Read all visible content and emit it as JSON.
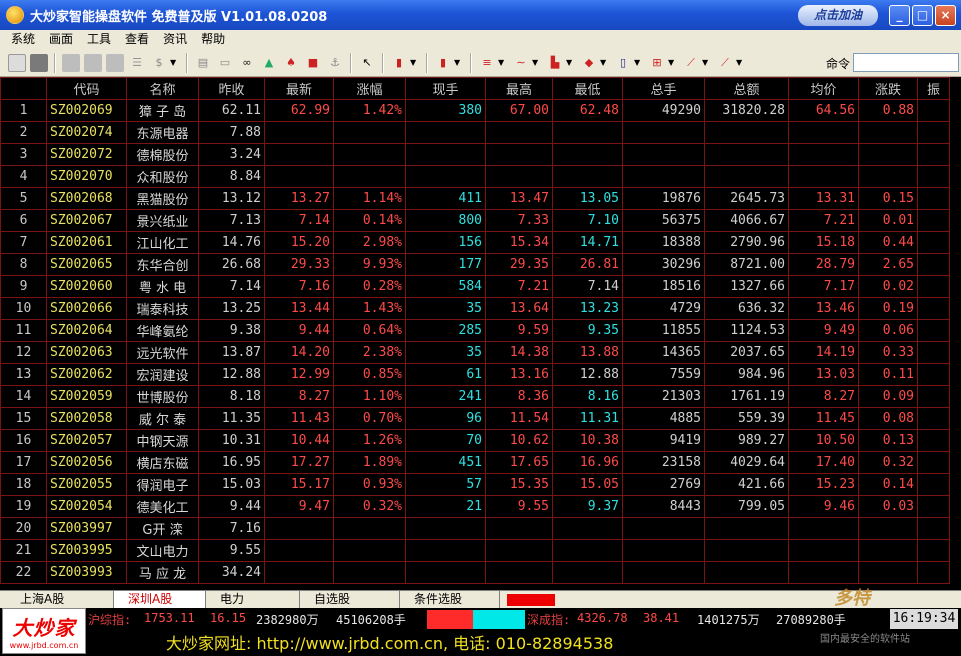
{
  "window": {
    "title": "大炒家智能操盘软件 免费普及版 V1.01.08.0208",
    "sponsor": "点击加油",
    "btn_min": "_",
    "btn_max": "□",
    "btn_close": "×"
  },
  "menu": [
    "系统",
    "画面",
    "工具",
    "查看",
    "资讯",
    "帮助"
  ],
  "toolbar": {
    "command_label": "命令",
    "command_value": ""
  },
  "columns": [
    "",
    "代码",
    "名称",
    "昨收",
    "最新",
    "涨幅",
    "现手",
    "最高",
    "最低",
    "总手",
    "总额",
    "均价",
    "涨跌",
    "振"
  ],
  "rows": [
    {
      "idx": "1",
      "code": "SZ002069",
      "name": "獐 子 岛",
      "prev": "62.11",
      "last": "62.99",
      "pct": "1.42%",
      "vol": "380",
      "high": "67.00",
      "low": "62.48",
      "total": "49290",
      "amount": "31820.28",
      "avg": "64.56",
      "chg": "0.88"
    },
    {
      "idx": "2",
      "code": "SZ002074",
      "name": "东源电器",
      "prev": "7.88",
      "last": "",
      "pct": "",
      "vol": "",
      "high": "",
      "low": "",
      "total": "",
      "amount": "",
      "avg": "",
      "chg": ""
    },
    {
      "idx": "3",
      "code": "SZ002072",
      "name": "德棉股份",
      "prev": "3.24",
      "last": "",
      "pct": "",
      "vol": "",
      "high": "",
      "low": "",
      "total": "",
      "amount": "",
      "avg": "",
      "chg": ""
    },
    {
      "idx": "4",
      "code": "SZ002070",
      "name": "众和股份",
      "prev": "8.84",
      "last": "",
      "pct": "",
      "vol": "",
      "high": "",
      "low": "",
      "total": "",
      "amount": "",
      "avg": "",
      "chg": ""
    },
    {
      "idx": "5",
      "code": "SZ002068",
      "name": "黑猫股份",
      "prev": "13.12",
      "last": "13.27",
      "pct": "1.14%",
      "vol": "411",
      "high": "13.47",
      "low": "13.05",
      "total": "19876",
      "amount": "2645.73",
      "avg": "13.31",
      "chg": "0.15"
    },
    {
      "idx": "6",
      "code": "SZ002067",
      "name": "景兴纸业",
      "prev": "7.13",
      "last": "7.14",
      "pct": "0.14%",
      "vol": "800",
      "high": "7.33",
      "low": "7.10",
      "total": "56375",
      "amount": "4066.67",
      "avg": "7.21",
      "chg": "0.01"
    },
    {
      "idx": "7",
      "code": "SZ002061",
      "name": "江山化工",
      "prev": "14.76",
      "last": "15.20",
      "pct": "2.98%",
      "vol": "156",
      "high": "15.34",
      "low": "14.71",
      "total": "18388",
      "amount": "2790.96",
      "avg": "15.18",
      "chg": "0.44"
    },
    {
      "idx": "8",
      "code": "SZ002065",
      "name": "东华合创",
      "prev": "26.68",
      "last": "29.33",
      "pct": "9.93%",
      "vol": "177",
      "high": "29.35",
      "low": "26.81",
      "total": "30296",
      "amount": "8721.00",
      "avg": "28.79",
      "chg": "2.65"
    },
    {
      "idx": "9",
      "code": "SZ002060",
      "name": "粤 水 电",
      "prev": "7.14",
      "last": "7.16",
      "pct": "0.28%",
      "vol": "584",
      "high": "7.21",
      "low": "7.14",
      "total": "18516",
      "amount": "1327.66",
      "avg": "7.17",
      "chg": "0.02"
    },
    {
      "idx": "10",
      "code": "SZ002066",
      "name": "瑞泰科技",
      "prev": "13.25",
      "last": "13.44",
      "pct": "1.43%",
      "vol": "35",
      "high": "13.64",
      "low": "13.23",
      "total": "4729",
      "amount": "636.32",
      "avg": "13.46",
      "chg": "0.19"
    },
    {
      "idx": "11",
      "code": "SZ002064",
      "name": "华峰氨纶",
      "prev": "9.38",
      "last": "9.44",
      "pct": "0.64%",
      "vol": "285",
      "high": "9.59",
      "low": "9.35",
      "total": "11855",
      "amount": "1124.53",
      "avg": "9.49",
      "chg": "0.06"
    },
    {
      "idx": "12",
      "code": "SZ002063",
      "name": "远光软件",
      "prev": "13.87",
      "last": "14.20",
      "pct": "2.38%",
      "vol": "35",
      "high": "14.38",
      "low": "13.88",
      "total": "14365",
      "amount": "2037.65",
      "avg": "14.19",
      "chg": "0.33"
    },
    {
      "idx": "13",
      "code": "SZ002062",
      "name": "宏润建设",
      "prev": "12.88",
      "last": "12.99",
      "pct": "0.85%",
      "vol": "61",
      "high": "13.16",
      "low": "12.88",
      "total": "7559",
      "amount": "984.96",
      "avg": "13.03",
      "chg": "0.11"
    },
    {
      "idx": "14",
      "code": "SZ002059",
      "name": "世博股份",
      "prev": "8.18",
      "last": "8.27",
      "pct": "1.10%",
      "vol": "241",
      "high": "8.36",
      "low": "8.16",
      "total": "21303",
      "amount": "1761.19",
      "avg": "8.27",
      "chg": "0.09"
    },
    {
      "idx": "15",
      "code": "SZ002058",
      "name": "威 尔 泰",
      "prev": "11.35",
      "last": "11.43",
      "pct": "0.70%",
      "vol": "96",
      "high": "11.54",
      "low": "11.31",
      "total": "4885",
      "amount": "559.39",
      "avg": "11.45",
      "chg": "0.08"
    },
    {
      "idx": "16",
      "code": "SZ002057",
      "name": "中钢天源",
      "prev": "10.31",
      "last": "10.44",
      "pct": "1.26%",
      "vol": "70",
      "high": "10.62",
      "low": "10.38",
      "total": "9419",
      "amount": "989.27",
      "avg": "10.50",
      "chg": "0.13"
    },
    {
      "idx": "17",
      "code": "SZ002056",
      "name": "横店东磁",
      "prev": "16.95",
      "last": "17.27",
      "pct": "1.89%",
      "vol": "451",
      "high": "17.65",
      "low": "16.96",
      "total": "23158",
      "amount": "4029.64",
      "avg": "17.40",
      "chg": "0.32"
    },
    {
      "idx": "18",
      "code": "SZ002055",
      "name": "得润电子",
      "prev": "15.03",
      "last": "15.17",
      "pct": "0.93%",
      "vol": "57",
      "high": "15.35",
      "low": "15.05",
      "total": "2769",
      "amount": "421.66",
      "avg": "15.23",
      "chg": "0.14"
    },
    {
      "idx": "19",
      "code": "SZ002054",
      "name": "德美化工",
      "prev": "9.44",
      "last": "9.47",
      "pct": "0.32%",
      "vol": "21",
      "high": "9.55",
      "low": "9.37",
      "total": "8443",
      "amount": "799.05",
      "avg": "9.46",
      "chg": "0.03"
    },
    {
      "idx": "20",
      "code": "SZ003997",
      "name": "G开 滦",
      "prev": "7.16",
      "last": "",
      "pct": "",
      "vol": "",
      "high": "",
      "low": "",
      "total": "",
      "amount": "",
      "avg": "",
      "chg": ""
    },
    {
      "idx": "21",
      "code": "SZ003995",
      "name": "文山电力",
      "prev": "9.55",
      "last": "",
      "pct": "",
      "vol": "",
      "high": "",
      "low": "",
      "total": "",
      "amount": "",
      "avg": "",
      "chg": ""
    },
    {
      "idx": "22",
      "code": "SZ003993",
      "name": "马 应 龙",
      "prev": "34.24",
      "last": "",
      "pct": "",
      "vol": "",
      "high": "",
      "low": "",
      "total": "",
      "amount": "",
      "avg": "",
      "chg": ""
    }
  ],
  "tabs": [
    "上海A股",
    "深圳A股",
    "电力",
    "自选股",
    "条件选股"
  ],
  "status": {
    "sh_label": "沪综指:",
    "sh_index": "1753.11",
    "sh_change": "16.15",
    "sh_amount": "2382980万",
    "sh_volume": "45106208手",
    "sz_label": "深成指:",
    "sz_index": "4326.78",
    "sz_change": "38.41",
    "sz_amount": "1401275万",
    "sz_volume": "27089280手",
    "time": "16:19:34"
  },
  "footer": "大炒家网址: http://www.jrbd.com.cn, 电话: 010-82894538",
  "logo": {
    "main": "大炒家",
    "sub": "www.jrbd.com.cn"
  },
  "watermark": {
    "main": "多特",
    "sub": "国内最安全的软件站"
  },
  "colors": {
    "up": "#ff4a4a",
    "vol": "#30e0e0",
    "grid": "#7a1414",
    "title": "#1d54d6"
  }
}
